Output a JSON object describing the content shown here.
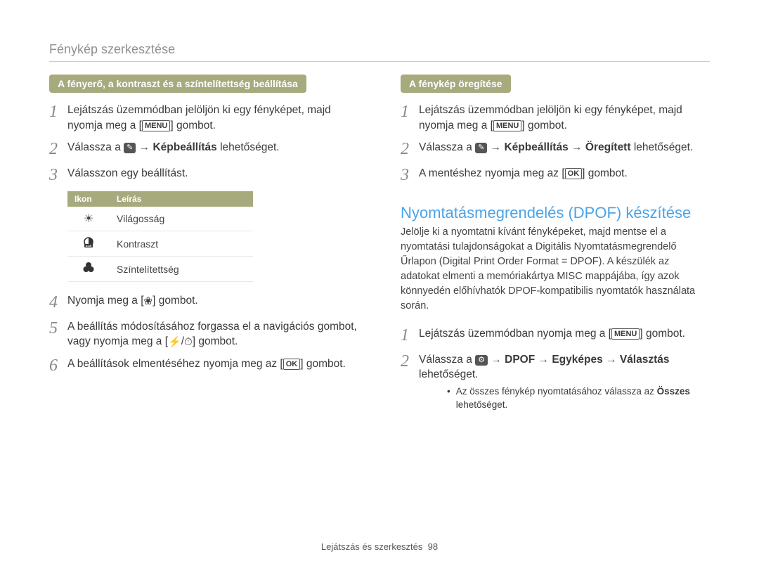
{
  "breadcrumb": "Fénykép szerkesztése",
  "left": {
    "pill": "A fényerő, a kontraszt és a színtelítettség beállítása",
    "steps": {
      "1": {
        "pre": "Lejátszás üzemmódban jelöljön ki egy fényképet, majd nyomja meg a [",
        "btn": "MENU",
        "post": "] gombot."
      },
      "2": {
        "pre": "Válassza a ",
        "chip": "✎",
        "target": "Képbeállítás",
        "post": " lehetőséget."
      },
      "3": "Válasszon egy beállítást.",
      "4": {
        "pre": "Nyomja meg a [",
        "icon": "❀",
        "post": "] gombot."
      },
      "5": {
        "pre": "A beállítás módosításához forgassa el a navigációs gombot, vagy nyomja meg a [",
        "icon1": "⚡",
        "icon2": "⏱",
        "post": "] gombot."
      },
      "6": {
        "pre": "A beállítások elmentéséhez nyomja meg az [",
        "btn": "OK",
        "post": "] gombot."
      }
    },
    "table": {
      "head1": "Ikon",
      "head2": "Leírás",
      "rows": [
        {
          "icon": "☀",
          "label": "Világosság"
        },
        {
          "iconSvg": "acb",
          "label": "Kontraszt"
        },
        {
          "icon": "⚫",
          "label": "Színtelítettség"
        }
      ]
    }
  },
  "right": {
    "pill": "A fénykép öregítése",
    "steps": {
      "1": {
        "pre": "Lejátszás üzemmódban jelöljön ki egy fényképet, majd nyomja meg a [",
        "btn": "MENU",
        "post": "] gombot."
      },
      "2": {
        "pre": "Válassza a ",
        "chip": "✎",
        "t1": "Képbeállítás",
        "t2": "Öregített",
        "post": " lehetőséget."
      },
      "3": {
        "pre": "A mentéshez nyomja meg az [",
        "btn": "OK",
        "post": "] gombot."
      }
    },
    "h2": "Nyomtatásmegrendelés (DPOF) készítése",
    "para": "Jelölje ki a nyomtatni kívánt fényképeket, majd mentse el a nyomtatási tulajdonságokat a Digitális Nyomtatásmegrendelő Űrlapon (Digital Print Order Format = DPOF). A készülék az adatokat elmenti a memóriakártya MISC mappájába, így azok könnyedén előhívhatók DPOF-kompatibilis nyomtatók használata során.",
    "steps2": {
      "1": {
        "pre": "Lejátszás üzemmódban nyomja meg a [",
        "btn": "MENU",
        "post": "] gombot."
      },
      "2": {
        "pre": "Válassza a ",
        "chip": "⚙",
        "t1": "DPOF",
        "t2": "Egyképes",
        "t3": "Választás",
        "post": " lehetőséget.",
        "sub": {
          "pre": "Az összes fénykép nyomtatásához válassza az ",
          "b": "Összes",
          "post": " lehetőséget."
        }
      }
    }
  },
  "footer": {
    "label": "Lejátszás és szerkesztés",
    "num": "98"
  }
}
